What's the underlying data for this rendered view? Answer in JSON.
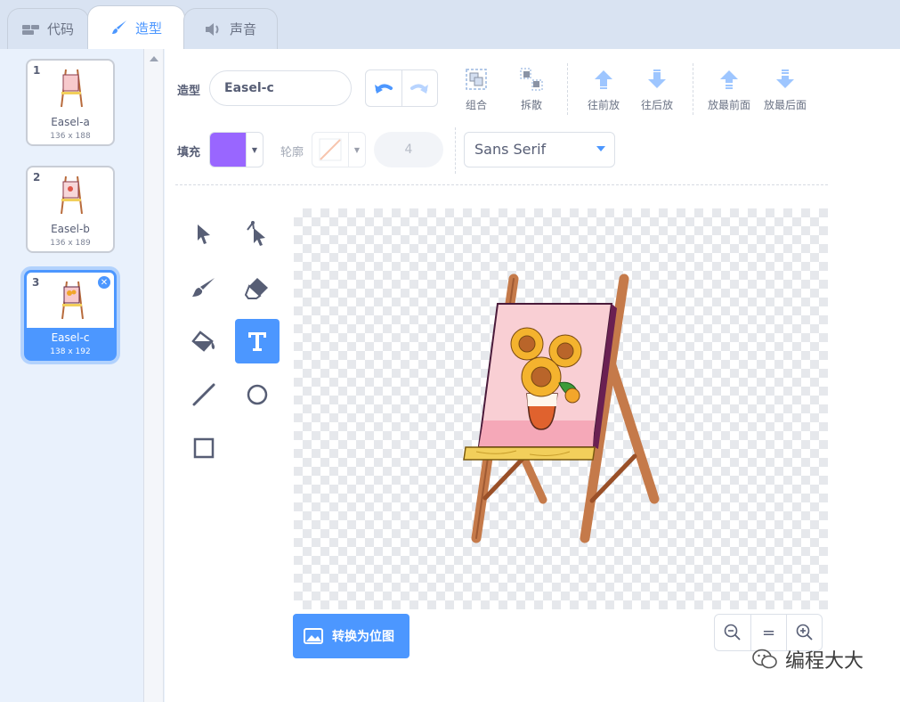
{
  "tabs": [
    {
      "label": "代码",
      "icon": "code-icon"
    },
    {
      "label": "造型",
      "icon": "brush-icon",
      "active": true
    },
    {
      "label": "声音",
      "icon": "speaker-icon"
    }
  ],
  "costumes": [
    {
      "number": "1",
      "name": "Easel-a",
      "size": "136 x 188"
    },
    {
      "number": "2",
      "name": "Easel-b",
      "size": "136 x 189"
    },
    {
      "number": "3",
      "name": "Easel-c",
      "size": "138 x 192",
      "selected": true
    }
  ],
  "toolbar": {
    "costume_label": "造型",
    "costume_name": "Easel-c",
    "group": "组合",
    "ungroup": "拆散",
    "forward": "往前放",
    "backward": "往后放",
    "front": "放最前面",
    "back": "放最后面",
    "fill_label": "填充",
    "fill_color": "#9966ff",
    "outline_label": "轮廓",
    "outline_width": "4",
    "font": "Sans Serif"
  },
  "tools": [
    "select-tool",
    "reshape-tool",
    "brush-tool",
    "eraser-tool",
    "fill-tool",
    "text-tool",
    "line-tool",
    "circle-tool",
    "rectangle-tool"
  ],
  "active_tool": "text-tool",
  "bitmap_button": "转换为位图",
  "zoom": {
    "out": "zoom-out-icon",
    "reset": "=",
    "in": "zoom-in-icon"
  },
  "watermark": "编程大大",
  "colors": {
    "accent": "#4c97ff",
    "fill": "#9966ff"
  }
}
